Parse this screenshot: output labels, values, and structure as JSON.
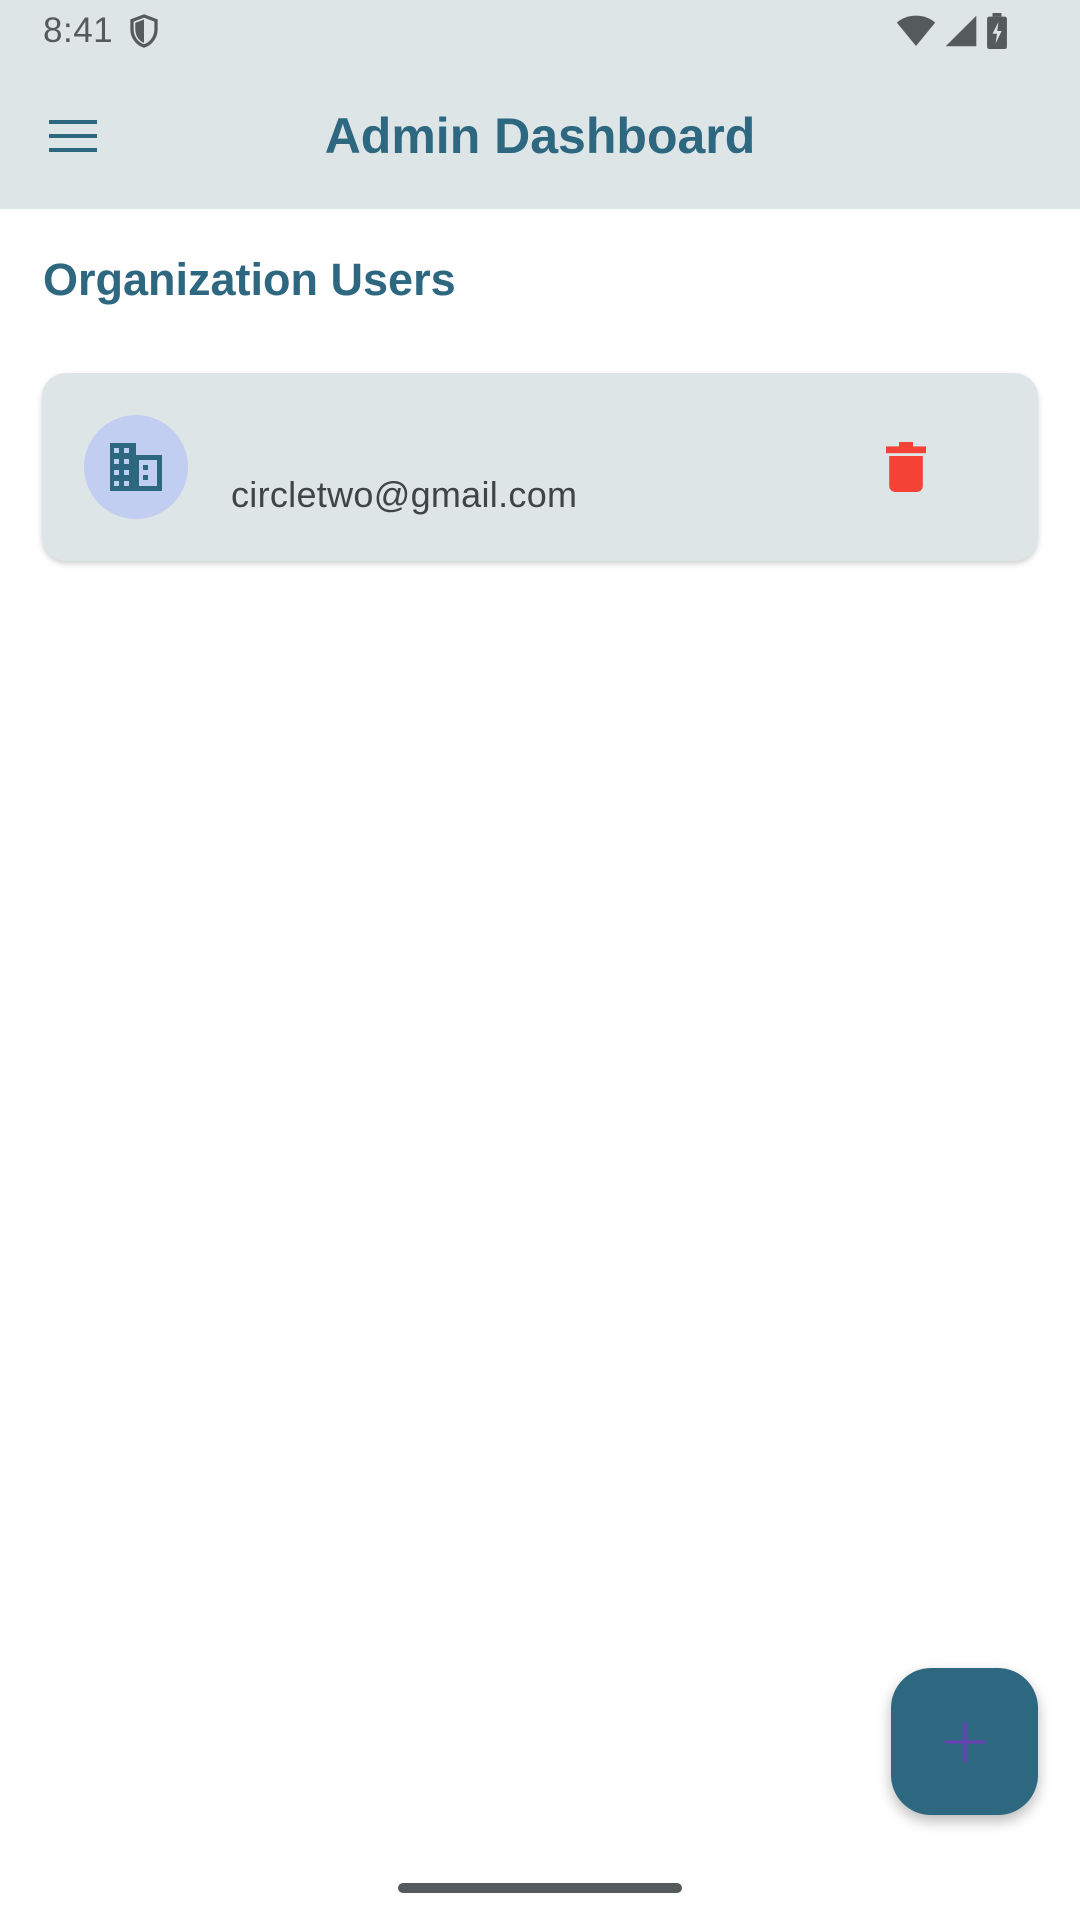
{
  "status_bar": {
    "time": "8:41",
    "icons": [
      "shield-icon",
      "wifi-icon",
      "signal-icon",
      "battery-charging-icon"
    ]
  },
  "app_bar": {
    "title": "Admin Dashboard",
    "menu_icon": "menu-icon"
  },
  "main": {
    "section_title": "Organization Users",
    "users": [
      {
        "email": "circletwo@gmail.com",
        "avatar_icon": "building-icon",
        "action_icon": "delete-icon"
      }
    ]
  },
  "fab": {
    "icon": "add-icon"
  },
  "colors": {
    "bar_background": "#dde5e6",
    "primary": "#2e6780",
    "avatar_background": "#c2cdf2",
    "delete": "#f44336",
    "fab_icon": "#6a3fb5"
  }
}
